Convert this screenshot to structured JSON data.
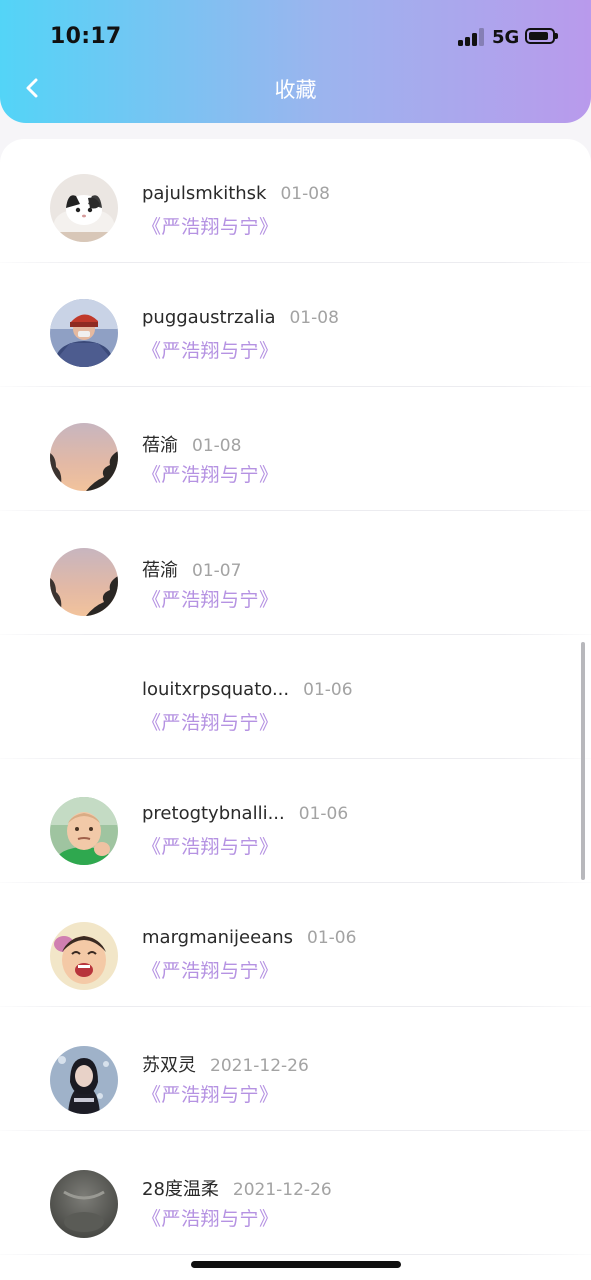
{
  "status_bar": {
    "time": "10:17",
    "network": "5G"
  },
  "nav": {
    "title": "收藏",
    "back_icon": "chevron-left-icon"
  },
  "items": [
    {
      "name": "pajulsmkithsk",
      "date": "01-08",
      "work": "《严浩翔与宁》",
      "avatar": "cat-photo"
    },
    {
      "name": "puggaustrzalia",
      "date": "01-08",
      "work": "《严浩翔与宁》",
      "avatar": "person-red-cap-photo"
    },
    {
      "name": "蓓渝",
      "date": "01-08",
      "work": "《严浩翔与宁》",
      "avatar": "sunset-tree-photo"
    },
    {
      "name": "蓓渝",
      "date": "01-07",
      "work": "《严浩翔与宁》",
      "avatar": "sunset-tree-photo"
    },
    {
      "name": "louitxrpsquato...",
      "date": "01-06",
      "work": "《严浩翔与宁》",
      "avatar": "none"
    },
    {
      "name": "pretogtybnalli...",
      "date": "01-06",
      "work": "《严浩翔与宁》",
      "avatar": "baby-fist-photo"
    },
    {
      "name": "margmanijeeans",
      "date": "01-06",
      "work": "《严浩翔与宁》",
      "avatar": "laughing-baby-photo"
    },
    {
      "name": "苏双灵",
      "date": "2021-12-26",
      "work": "《严浩翔与宁》",
      "avatar": "woman-dark-photo"
    },
    {
      "name": "28度温柔",
      "date": "2021-12-26",
      "work": "《严浩翔与宁》",
      "avatar": "gray-photo"
    }
  ],
  "colors": {
    "header_gradient": [
      "#53d4f7",
      "#9cb4ee",
      "#b99aec"
    ],
    "work_title": "#b592e2",
    "date_text": "#a3a3a3",
    "name_text": "#2a2a2a"
  }
}
